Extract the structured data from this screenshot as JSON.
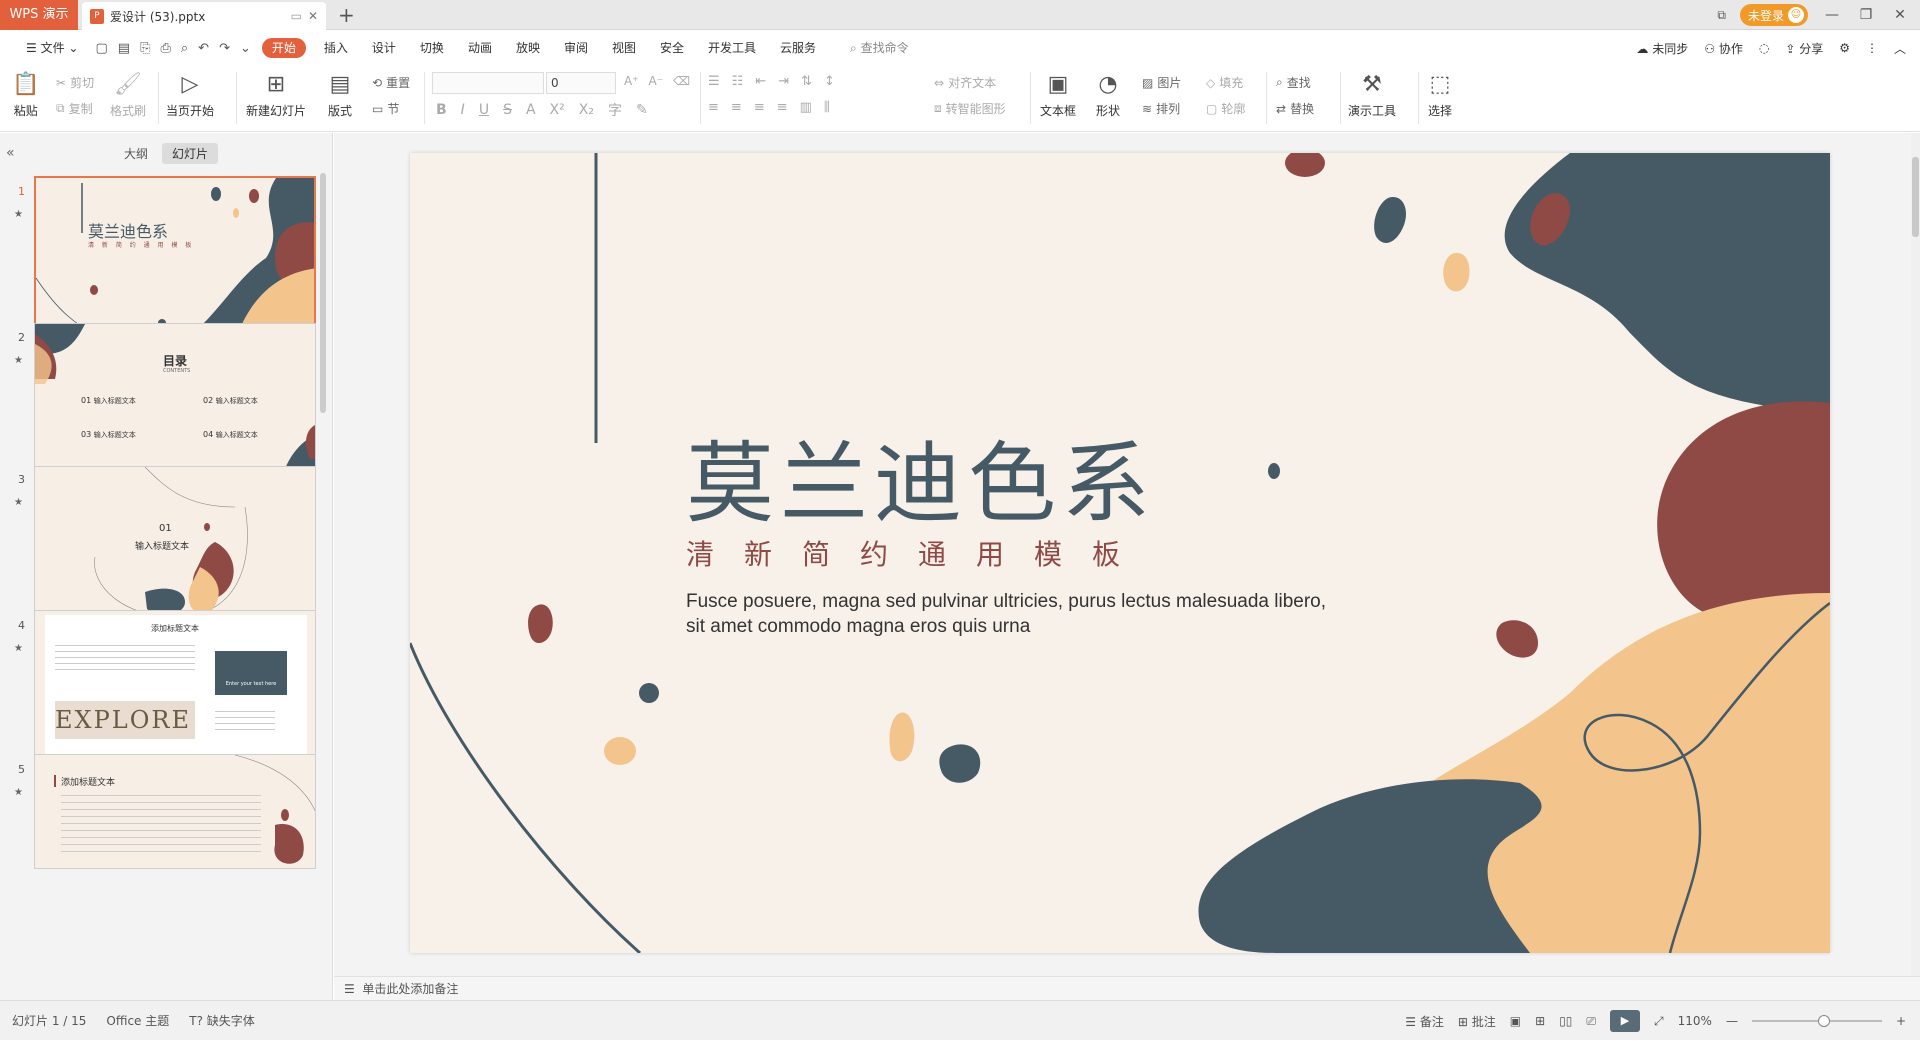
{
  "app": {
    "name": "WPS 演示"
  },
  "document": {
    "tab_title": "爱设计 (53).pptx"
  },
  "titlebar": {
    "login_label": "未登录",
    "minimize_icon": "minimize-icon",
    "maximize_icon": "maximize-icon",
    "close_icon": "close-icon"
  },
  "menu": {
    "file": "文件",
    "tabs": [
      "开始",
      "插入",
      "设计",
      "切换",
      "动画",
      "放映",
      "审阅",
      "视图",
      "安全",
      "开发工具",
      "云服务"
    ],
    "active_tab": "开始",
    "search_placeholder": "查找命令",
    "right": [
      "未同步",
      "协作",
      "分享"
    ]
  },
  "ribbon": {
    "paste": "粘贴",
    "cut": "剪切",
    "copy": "复制",
    "format_painter": "格式刷",
    "start_show": "当页开始",
    "new_slide": "新建幻灯片",
    "layout": "版式",
    "reset": "重置",
    "section": "节",
    "font_size": "0",
    "align_text": "对齐文本",
    "smart_art": "转智能图形",
    "text_box": "文本框",
    "shape": "形状",
    "picture": "图片",
    "arrange": "排列",
    "fill": "填充",
    "outline": "轮廓",
    "find": "查找",
    "replace": "替换",
    "tools": "演示工具",
    "select": "选择"
  },
  "panel": {
    "tab_outline": "大纲",
    "tab_slides": "幻灯片",
    "active": "幻灯片"
  },
  "thumbnails": [
    {
      "num": "1",
      "title": "莫兰迪色系",
      "subtitle": "清 新 简 约 通 用 模 板"
    },
    {
      "num": "2",
      "title": "目录",
      "subtitle": "CONTENTS",
      "items": [
        "01",
        "输入标题文本",
        "02",
        "输入标题文本",
        "03",
        "输入标题文本",
        "04",
        "输入标题文本"
      ]
    },
    {
      "num": "3",
      "title": "01",
      "subtitle": "输入标题文本"
    },
    {
      "num": "4",
      "title": "添加标题文本",
      "badge": "Enter your text here",
      "image_text": "EXPLORE"
    },
    {
      "num": "5",
      "title": "添加标题文本"
    }
  ],
  "slide": {
    "title": "莫兰迪色系",
    "subtitle": "清新简约通用模板",
    "body": "Fusce posuere, magna sed pulvinar ultricies, purus lectus malesuada libero, sit amet commodo magna eros quis urna"
  },
  "notes": {
    "placeholder": "单击此处添加备注"
  },
  "status": {
    "slide_counter": "幻灯片 1 / 15",
    "theme": "Office 主题",
    "missing_font": "缺失字体",
    "notes": "备注",
    "comments": "批注",
    "zoom": "110%"
  },
  "colors": {
    "accent": "#e3603d",
    "slate": "#465a66",
    "rust": "#8f4a45",
    "sand": "#f3c48c",
    "paper": "#f8f1ea"
  }
}
